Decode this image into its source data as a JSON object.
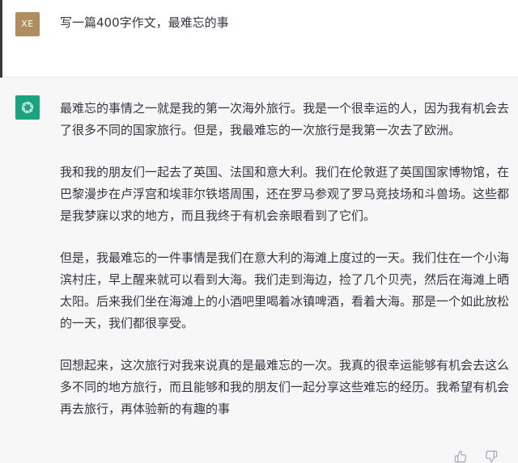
{
  "user": {
    "avatar_initials": "XE",
    "prompt": "写一篇400字作文，最难忘的事"
  },
  "assistant": {
    "avatar_icon": "openai-logo-icon",
    "paragraphs": [
      "最难忘的事情之一就是我的第一次海外旅行。我是一个很幸运的人，因为我有机会去了很多不同的国家旅行。但是，我最难忘的一次旅行是我第一次去了欧洲。",
      "我和我的朋友们一起去了英国、法国和意大利。我们在伦敦逛了英国国家博物馆，在巴黎漫步在卢浮宫和埃菲尔铁塔周围，还在罗马参观了罗马竞技场和斗兽场。这些都是我梦寐以求的地方，而且我终于有机会亲眼看到了它们。",
      "但是，我最难忘的一件事情是我们在意大利的海滩上度过的一天。我们住在一个小海滨村庄，早上醒来就可以看到大海。我们走到海边，捡了几个贝壳，然后在海滩上晒太阳。后来我们坐在海滩上的小酒吧里喝着冰镇啤酒，看着大海。那是一个如此放松的一天，我们都很享受。",
      "回想起来，这次旅行对我来说真的是最难忘的一次。我真的很幸运能够有机会去这么多不同的地方旅行，而且能够和我的朋友们一起分享这些难忘的经历。我希望有机会再去旅行，再体验新的有趣的事"
    ],
    "feedback": {
      "thumbs_up_icon": "thumbs-up-icon",
      "thumbs_down_icon": "thumbs-down-icon"
    }
  },
  "colors": {
    "user_avatar": "#b08d5f",
    "assistant_avatar": "#19a37f",
    "assistant_background": "#f7f7f8",
    "text": "#343541"
  }
}
